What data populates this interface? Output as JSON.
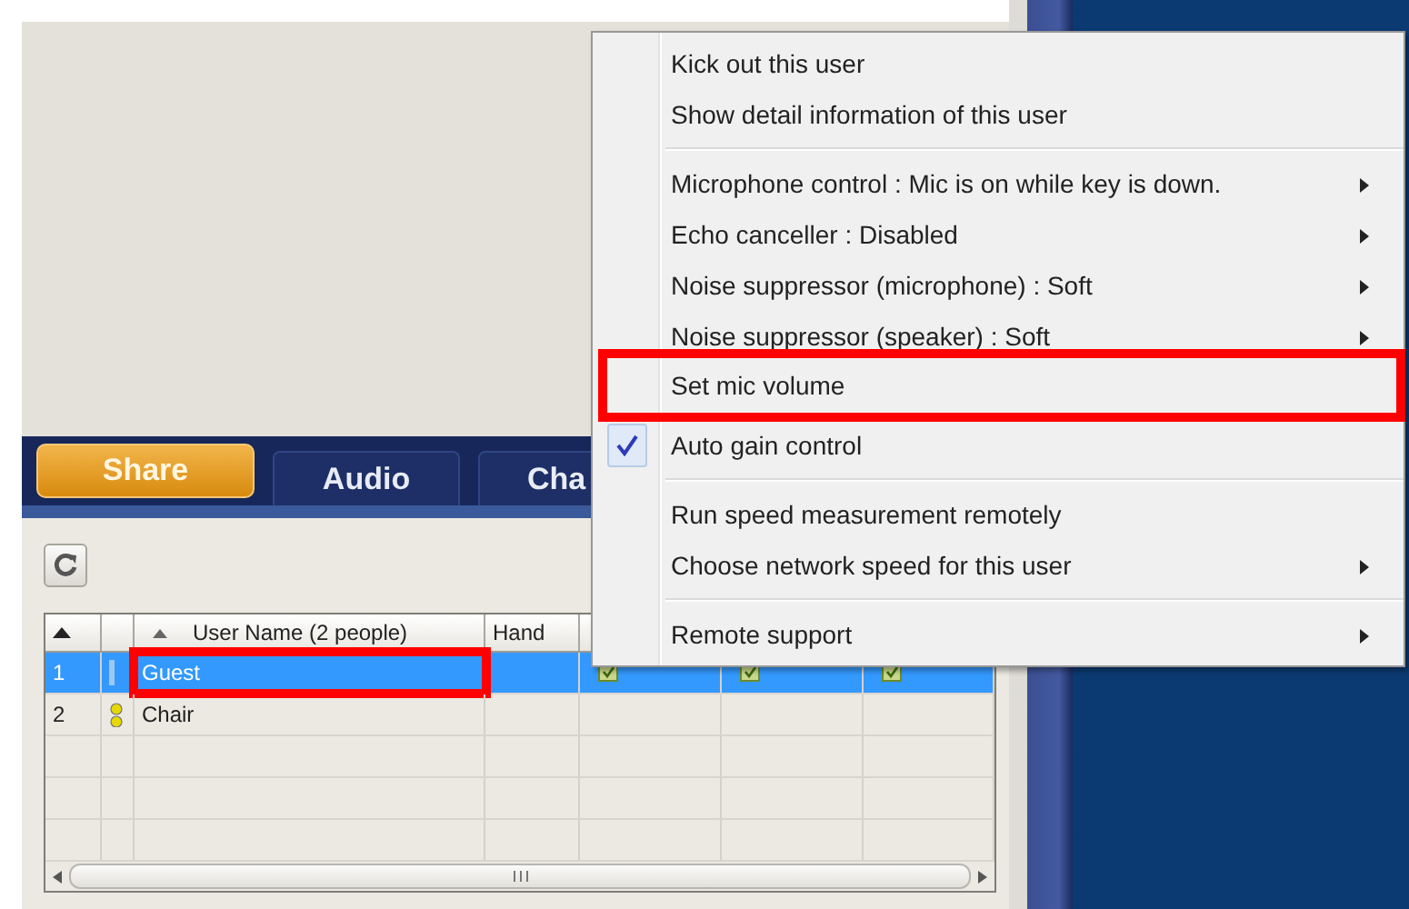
{
  "tabs": [
    {
      "label": "Share",
      "selected": true
    },
    {
      "label": "Audio",
      "selected": false
    },
    {
      "label": "Cha",
      "selected": false
    }
  ],
  "table": {
    "columns": [
      "User Name (2 people)",
      "Hand"
    ],
    "rows": [
      {
        "number": "1",
        "name": "Guest",
        "selected": true,
        "highlighted": true,
        "icon": false,
        "flags": [
          true,
          true,
          true
        ]
      },
      {
        "number": "2",
        "name": "Chair",
        "selected": false,
        "highlighted": false,
        "icon": true,
        "flags": [
          false,
          false,
          false
        ]
      }
    ]
  },
  "context_menu": {
    "items": [
      {
        "kind": "item",
        "label": "Kick out this user",
        "submenu": false,
        "checked": false,
        "highlighted": false
      },
      {
        "kind": "item",
        "label": "Show detail information of this user",
        "submenu": false,
        "checked": false,
        "highlighted": false
      },
      {
        "kind": "separator"
      },
      {
        "kind": "item",
        "label": "Microphone control : Mic is on while key is down.",
        "submenu": true,
        "checked": false,
        "highlighted": false
      },
      {
        "kind": "item",
        "label": "Echo canceller : Disabled",
        "submenu": true,
        "checked": false,
        "highlighted": false
      },
      {
        "kind": "item",
        "label": "Noise suppressor (microphone) : Soft",
        "submenu": true,
        "checked": false,
        "highlighted": false
      },
      {
        "kind": "item",
        "label": "Noise suppressor (speaker) : Soft",
        "submenu": true,
        "checked": false,
        "highlighted": false
      },
      {
        "kind": "item",
        "label": "Set mic volume",
        "submenu": false,
        "checked": false,
        "highlighted": true
      },
      {
        "kind": "item",
        "label": "Auto gain control",
        "submenu": false,
        "checked": true,
        "highlighted": false
      },
      {
        "kind": "separator"
      },
      {
        "kind": "item",
        "label": "Run speed measurement remotely",
        "submenu": false,
        "checked": false,
        "highlighted": false
      },
      {
        "kind": "item",
        "label": "Choose network speed for this user",
        "submenu": true,
        "checked": false,
        "highlighted": false
      },
      {
        "kind": "separator"
      },
      {
        "kind": "item",
        "label": "Remote support",
        "submenu": true,
        "checked": false,
        "highlighted": false
      }
    ]
  }
}
